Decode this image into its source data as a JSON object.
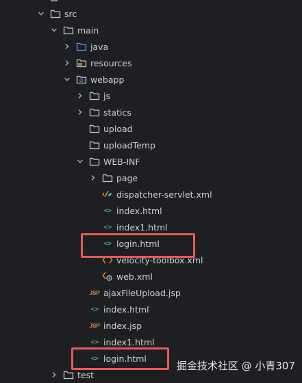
{
  "tree": [
    {
      "id": "src",
      "label": "src",
      "type": "folder",
      "expanded": true
    },
    {
      "id": "main",
      "label": "main",
      "type": "folder",
      "expanded": true
    },
    {
      "id": "java",
      "label": "java",
      "type": "source-folder",
      "expanded": false
    },
    {
      "id": "resources",
      "label": "resources",
      "type": "resources-folder",
      "expanded": false
    },
    {
      "id": "webapp",
      "label": "webapp",
      "type": "web-folder",
      "expanded": true
    },
    {
      "id": "js",
      "label": "js",
      "type": "folder",
      "expanded": false
    },
    {
      "id": "statics",
      "label": "statics",
      "type": "folder",
      "expanded": false
    },
    {
      "id": "upload",
      "label": "upload",
      "type": "folder"
    },
    {
      "id": "uploadTemp",
      "label": "uploadTemp",
      "type": "folder"
    },
    {
      "id": "web-inf",
      "label": "WEB-INF",
      "type": "folder",
      "expanded": true
    },
    {
      "id": "page",
      "label": "page",
      "type": "folder",
      "expanded": false
    },
    {
      "id": "dispatcher",
      "label": "dispatcher-servlet.xml",
      "type": "xml-config"
    },
    {
      "id": "index-html-inner",
      "label": "index.html",
      "type": "html"
    },
    {
      "id": "index1-html-inner",
      "label": "index1.html",
      "type": "html"
    },
    {
      "id": "login-html-inner",
      "label": "login.html",
      "type": "html",
      "highlighted": true
    },
    {
      "id": "velocity",
      "label": "velocity-toolbox.xml",
      "type": "xml"
    },
    {
      "id": "web-xml",
      "label": "web.xml",
      "type": "xml-web"
    },
    {
      "id": "ajax-jsp",
      "label": "ajaxFileUpload.jsp",
      "type": "jsp"
    },
    {
      "id": "index-html",
      "label": "index.html",
      "type": "html"
    },
    {
      "id": "index-jsp",
      "label": "index.jsp",
      "type": "jsp"
    },
    {
      "id": "index1-html",
      "label": "index1.html",
      "type": "html"
    },
    {
      "id": "login-html",
      "label": "login.html",
      "type": "html",
      "highlighted": true
    },
    {
      "id": "test",
      "label": "test",
      "type": "folder",
      "expanded": false
    }
  ],
  "icons": {
    "html_tag": "<>",
    "jsp_tag": "JSP"
  },
  "colors": {
    "highlight_border": "#e85a5a",
    "html_icon": "#4ec985",
    "jsp_icon": "#e0893a",
    "folder_outline": "#c7c9cf",
    "source_folder": "#5b9cf5",
    "background": "#1e1f22"
  },
  "watermark": "掘金技术社区 @ 小青307"
}
